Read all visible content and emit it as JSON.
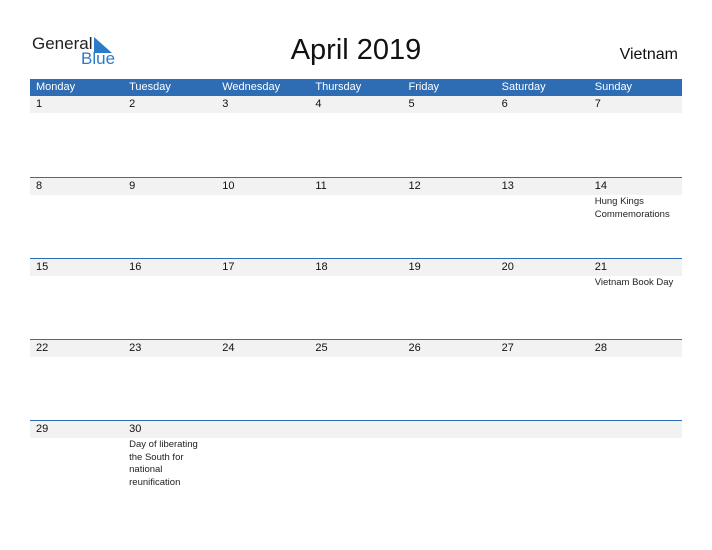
{
  "logo": {
    "word1": "General",
    "word2": "Blue",
    "accent": "#2a7bc8"
  },
  "title": "April 2019",
  "country": "Vietnam",
  "colors": {
    "header_bg": "#2e6db3",
    "band_bg": "#f2f2f2"
  },
  "weekdays": [
    "Monday",
    "Tuesday",
    "Wednesday",
    "Thursday",
    "Friday",
    "Saturday",
    "Sunday"
  ],
  "weeks": [
    {
      "days": [
        {
          "n": "1",
          "e": ""
        },
        {
          "n": "2",
          "e": ""
        },
        {
          "n": "3",
          "e": ""
        },
        {
          "n": "4",
          "e": ""
        },
        {
          "n": "5",
          "e": ""
        },
        {
          "n": "6",
          "e": ""
        },
        {
          "n": "7",
          "e": ""
        }
      ]
    },
    {
      "days": [
        {
          "n": "8",
          "e": ""
        },
        {
          "n": "9",
          "e": ""
        },
        {
          "n": "10",
          "e": ""
        },
        {
          "n": "11",
          "e": ""
        },
        {
          "n": "12",
          "e": ""
        },
        {
          "n": "13",
          "e": ""
        },
        {
          "n": "14",
          "e": "Hung Kings Commemorations"
        }
      ]
    },
    {
      "days": [
        {
          "n": "15",
          "e": ""
        },
        {
          "n": "16",
          "e": ""
        },
        {
          "n": "17",
          "e": ""
        },
        {
          "n": "18",
          "e": ""
        },
        {
          "n": "19",
          "e": ""
        },
        {
          "n": "20",
          "e": ""
        },
        {
          "n": "21",
          "e": "Vietnam Book Day"
        }
      ]
    },
    {
      "days": [
        {
          "n": "22",
          "e": ""
        },
        {
          "n": "23",
          "e": ""
        },
        {
          "n": "24",
          "e": ""
        },
        {
          "n": "25",
          "e": ""
        },
        {
          "n": "26",
          "e": ""
        },
        {
          "n": "27",
          "e": ""
        },
        {
          "n": "28",
          "e": ""
        }
      ]
    },
    {
      "days": [
        {
          "n": "29",
          "e": ""
        },
        {
          "n": "30",
          "e": "Day of liberating the South for national reunification"
        },
        {
          "n": "",
          "e": ""
        },
        {
          "n": "",
          "e": ""
        },
        {
          "n": "",
          "e": ""
        },
        {
          "n": "",
          "e": ""
        },
        {
          "n": "",
          "e": ""
        }
      ]
    }
  ]
}
